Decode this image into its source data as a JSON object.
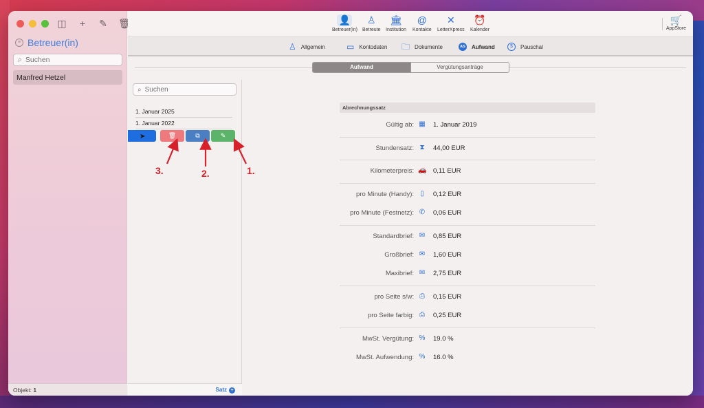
{
  "sidebar": {
    "title": "Betreuer(in)",
    "search_placeholder": "Suchen",
    "items": [
      {
        "label": "Manfred Hetzel"
      }
    ],
    "status_label": "Objekt:",
    "status_count": "1"
  },
  "toolbar": {
    "buttons": [
      {
        "label": "Betreuer(in)",
        "icon": "person-badge-icon"
      },
      {
        "label": "Betreute",
        "icon": "person-icon"
      },
      {
        "label": "Institution",
        "icon": "bank-icon"
      },
      {
        "label": "Kontakte",
        "icon": "at-icon"
      },
      {
        "label": "LetterXpress",
        "icon": "letterxpress-icon"
      },
      {
        "label": "Kalender",
        "icon": "alarm-clock-icon"
      }
    ],
    "appstore_label": "AppStore"
  },
  "subtabs": [
    {
      "label": "Allgemein",
      "icon": "person-icon"
    },
    {
      "label": "Kontodaten",
      "icon": "card-icon"
    },
    {
      "label": "Dokumente",
      "icon": "folder-icon"
    },
    {
      "label": "Aufwand",
      "icon": "as-badge-icon",
      "badge": "AS"
    },
    {
      "label": "Pauschal",
      "icon": "dollar-circle-icon",
      "badge": "$"
    }
  ],
  "segment": {
    "tabs": [
      "Aufwand",
      "Vergütungsanträge"
    ],
    "selected": "Aufwand"
  },
  "list": {
    "search_placeholder": "Suchen",
    "rows": [
      "1. Januar 2025",
      "1. Januar 2022"
    ],
    "add_label": "Satz",
    "swipe_actions": [
      "delete",
      "duplicate",
      "edit"
    ]
  },
  "annotations": [
    "3.",
    "2.",
    "1."
  ],
  "detail": {
    "section_title": "Abrechnungssatz",
    "rows": [
      {
        "label": "Gültig ab:",
        "value": "1. Januar 2019",
        "icon": "calendar-icon"
      },
      {
        "label": "Stundensatz:",
        "value": "44,00 EUR",
        "icon": "hourglass-icon"
      },
      {
        "label": "Kilometerpreis:",
        "value": "0,11 EUR",
        "icon": "car-icon"
      },
      {
        "label": "pro Minute (Handy):",
        "value": "0,12 EUR",
        "icon": "mobile-phone-icon"
      },
      {
        "label": "pro Minute (Festnetz):",
        "value": "0,06 EUR",
        "icon": "phone-icon"
      },
      {
        "label": "Standardbrief:",
        "value": "0,85 EUR",
        "icon": "envelope-icon"
      },
      {
        "label": "Großbrief:",
        "value": "1,60 EUR",
        "icon": "envelope-icon"
      },
      {
        "label": "Maxibrief:",
        "value": "2,75 EUR",
        "icon": "envelope-icon"
      },
      {
        "label": "pro Seite s/w:",
        "value": "0,15 EUR",
        "icon": "printer-icon"
      },
      {
        "label": "pro Seite farbig:",
        "value": "0,25 EUR",
        "icon": "printer-icon"
      },
      {
        "label": "MwSt. Vergütung:",
        "value": "19.0 %",
        "icon": "percent-icon"
      },
      {
        "label": "MwSt. Aufwendung:",
        "value": "16.0 %",
        "icon": "percent-icon"
      }
    ]
  },
  "colors": {
    "accent": "#2f6fd8",
    "delete": "#ef7a7e",
    "duplicate": "#4a7fc4",
    "edit": "#5cb46a",
    "annotation": "#d8202a"
  }
}
